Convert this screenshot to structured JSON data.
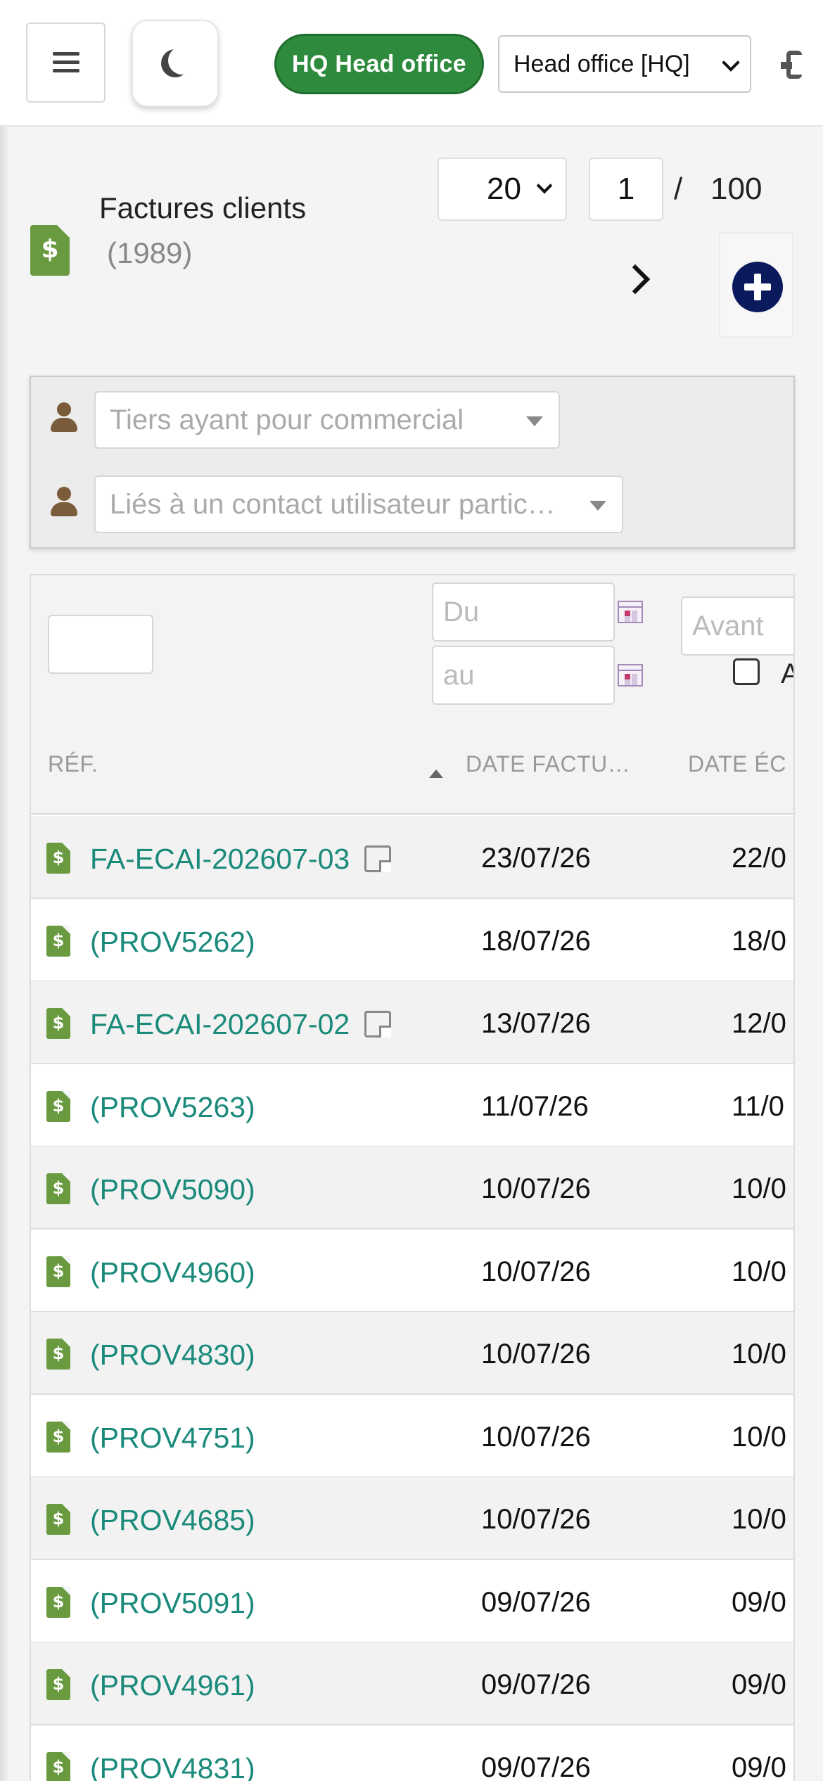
{
  "topbar": {
    "entity_badge": "HQ Head office",
    "entity_select": "Head office [HQ]"
  },
  "header": {
    "title": "Factures clients",
    "count": "(1989)",
    "limit": "20",
    "page": "1",
    "page_sep": "/",
    "page_total": "100"
  },
  "filters": {
    "sales_rep_placeholder": "Tiers ayant pour commercial",
    "contact_placeholder": "Liés à un contact utilisateur partic…"
  },
  "table": {
    "date_from_placeholder": "Du",
    "date_to_placeholder": "au",
    "due_before_placeholder": "Avant",
    "checkbox_label": "A",
    "columns": {
      "ref": "RÉF.",
      "invoice_date": "DATE FACTU…",
      "due_date": "DATE ÉC"
    },
    "rows": [
      {
        "ref": "FA-ECAI-202607-03",
        "date": "23/07/26",
        "due": "22/0",
        "note": true
      },
      {
        "ref": "(PROV5262)",
        "date": "18/07/26",
        "due": "18/0",
        "note": false
      },
      {
        "ref": "FA-ECAI-202607-02",
        "date": "13/07/26",
        "due": "12/0",
        "note": true
      },
      {
        "ref": "(PROV5263)",
        "date": "11/07/26",
        "due": "11/0",
        "note": false
      },
      {
        "ref": "(PROV5090)",
        "date": "10/07/26",
        "due": "10/0",
        "note": false
      },
      {
        "ref": "(PROV4960)",
        "date": "10/07/26",
        "due": "10/0",
        "note": false
      },
      {
        "ref": "(PROV4830)",
        "date": "10/07/26",
        "due": "10/0",
        "note": false
      },
      {
        "ref": "(PROV4751)",
        "date": "10/07/26",
        "due": "10/0",
        "note": false
      },
      {
        "ref": "(PROV4685)",
        "date": "10/07/26",
        "due": "10/0",
        "note": false
      },
      {
        "ref": "(PROV5091)",
        "date": "09/07/26",
        "due": "09/0",
        "note": false
      },
      {
        "ref": "(PROV4961)",
        "date": "09/07/26",
        "due": "09/0",
        "note": false
      },
      {
        "ref": "(PROV4831)",
        "date": "09/07/26",
        "due": "09/0",
        "note": false
      }
    ]
  },
  "colors": {
    "accent_green": "#2e8b3e",
    "link_teal": "#1a8a7a",
    "doc_icon_green": "#6a9a3f",
    "add_button_navy": "#0b1a5c",
    "user_icon_brown": "#7a5c3a"
  },
  "icons": {
    "menu": "hamburger-icon",
    "dark_mode": "moon-icon",
    "page": "invoice-icon",
    "next": "chevron-right-icon",
    "add": "plus-circle-icon",
    "user": "user-icon",
    "calendar": "calendar-icon",
    "note": "note-icon"
  }
}
